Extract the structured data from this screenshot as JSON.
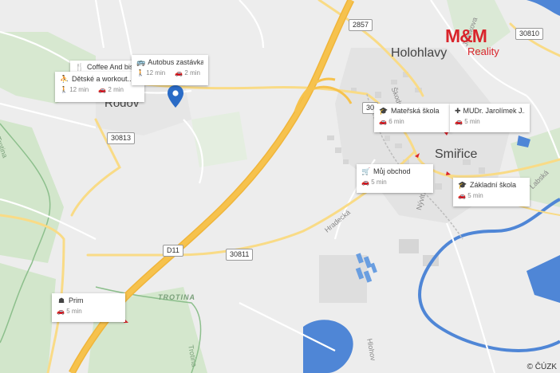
{
  "map": {
    "towns": {
      "holohlavy": "Holohlavy",
      "rodov": "Rodov",
      "smirice": "Smiřice"
    },
    "streets": {
      "skodni": "Škodní",
      "hradecka": "Hradecká",
      "nyvlt": "Nývlt",
      "jiraskova": "Jiráskova",
      "labska": "Labská",
      "hlohova": "Hlohov"
    },
    "rivers": {
      "trotina_main": "TROTINA",
      "trotina_side1": "Trotina",
      "trotina_side2": "Trotina"
    },
    "road_shields": {
      "r2857": "2857",
      "r30810": "30810",
      "r30813": "30813",
      "r30811": "30811",
      "rd11": "D11",
      "r30_partial": "30"
    }
  },
  "pois": [
    {
      "title": "Coffee And bistro",
      "icon": "cutlery-icon"
    },
    {
      "title": "Autobus zastávka",
      "icon": "bus-icon",
      "walk": "12 min",
      "car": "2 min"
    },
    {
      "title": "Dětské a workout...",
      "icon": "playground-icon",
      "walk": "12 min",
      "car": "2 min"
    },
    {
      "title": "Mateřská škola",
      "icon": "school-icon",
      "car": "6 min"
    },
    {
      "title": "MUDr. Jarolímek J...",
      "icon": "medical-icon",
      "car": "5 min"
    },
    {
      "title": "Můj obchod",
      "icon": "cart-icon",
      "car": "5 min"
    },
    {
      "title": "Základní škola",
      "icon": "school-icon",
      "car": "5 min"
    },
    {
      "title": "Prim",
      "icon": "network-icon",
      "car": "5 min"
    }
  ],
  "brand": {
    "logo": "M&M",
    "sub": "Reality",
    "color": "#d9242b"
  },
  "attribution": "© ČÚZK",
  "colors": {
    "background": "#ededed",
    "green": "#cde3c6",
    "water": "#4f86d6",
    "motorway": "#f6c24d",
    "road": "#f9db86",
    "pin": "#2a6bc6"
  }
}
